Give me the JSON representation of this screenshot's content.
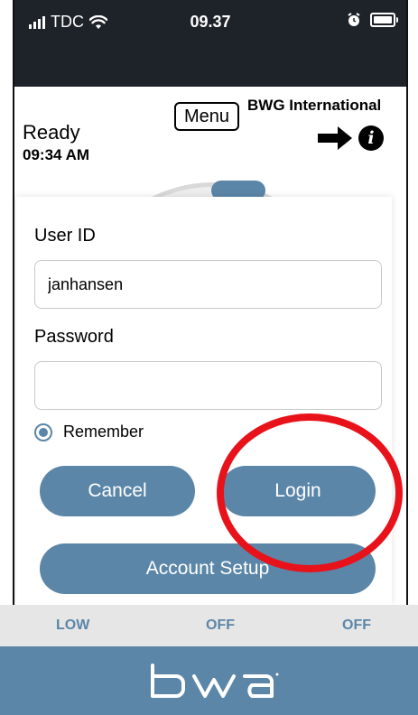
{
  "status_bar": {
    "carrier": "TDC",
    "time": "09.37"
  },
  "header": {
    "state": "Ready",
    "time": "09:34 AM",
    "menu_label": "Menu",
    "brand_name": "BWG International"
  },
  "login": {
    "user_id_label": "User ID",
    "user_id_value": "janhansen",
    "password_label": "Password",
    "password_value": "",
    "remember_label": "Remember",
    "remember_checked": true,
    "cancel_label": "Cancel",
    "login_label": "Login",
    "account_setup_label": "Account Setup"
  },
  "status_strip": [
    "LOW",
    "OFF",
    "OFF"
  ],
  "footer": {
    "logo": "bwa"
  },
  "colors": {
    "accent": "#5b86a8",
    "highlight": "#e8121a",
    "status_bar_bg": "#1e2229"
  }
}
